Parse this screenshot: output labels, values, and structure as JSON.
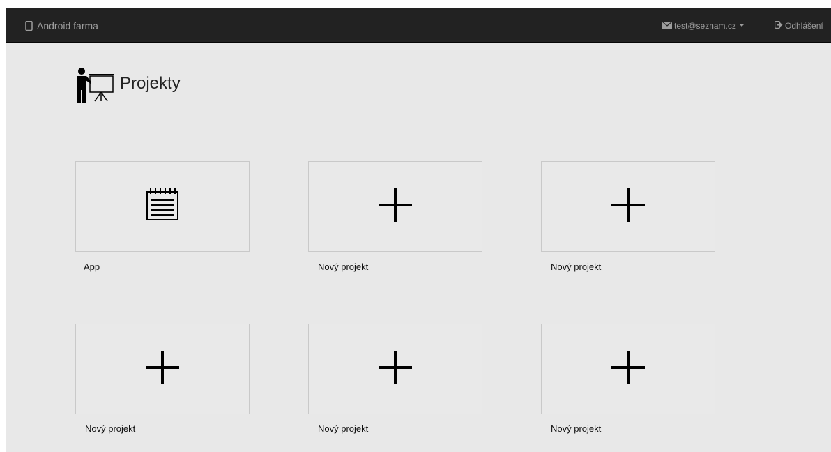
{
  "navbar": {
    "brand": "Android farma",
    "user_email": "test@seznam.cz",
    "logout": "Odhlášení",
    "colors": {
      "background": "#222222",
      "text": "#9d9d9d"
    }
  },
  "header": {
    "title": "Projekty",
    "icon": "presentation-icon"
  },
  "projects": [
    {
      "label": "App",
      "icon": "notepad-icon"
    },
    {
      "label": "Nový projekt",
      "icon": "plus-icon"
    },
    {
      "label": "Nový projekt",
      "icon": "plus-icon"
    },
    {
      "label": "Nový projekt",
      "icon": "plus-icon"
    },
    {
      "label": "Nový projekt",
      "icon": "plus-icon"
    },
    {
      "label": "Nový projekt",
      "icon": "plus-icon"
    }
  ]
}
